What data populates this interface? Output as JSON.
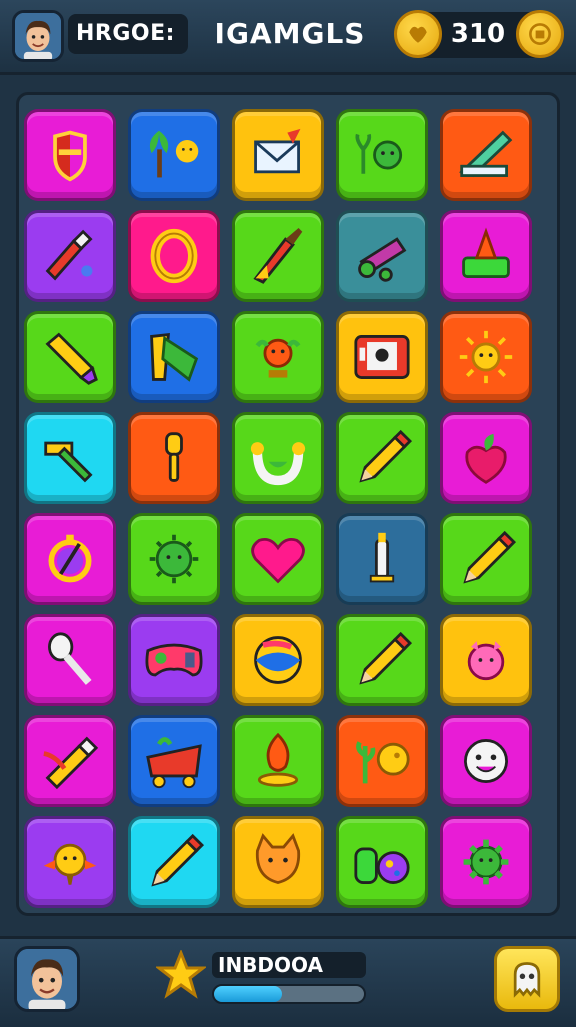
{
  "header": {
    "player_name": "HRGOE:",
    "title": "IGAMGLS",
    "coins": "310"
  },
  "footer": {
    "level_label": "INBDOOA",
    "progress": 0.45
  },
  "colors": {
    "magenta": "#e81cd6",
    "blue": "#1f6fe6",
    "yellow": "#ffc20e",
    "green": "#57d81a",
    "orange": "#ff5a14",
    "purple": "#9b3cf0",
    "pink": "#ff1a8c",
    "teal": "#3a8f9a",
    "cyan": "#1fd8f2",
    "darkblue": "#2d6e9c"
  },
  "board": {
    "rows": [
      [
        {
          "color": "magenta",
          "icon": "shield-icon"
        },
        {
          "color": "blue",
          "icon": "tree-sun-icon"
        },
        {
          "color": "yellow",
          "icon": "envelope-icon"
        },
        {
          "color": "green",
          "icon": "plant-creature-icon"
        },
        {
          "color": "orange",
          "icon": "ruler-icon"
        }
      ],
      [
        {
          "color": "purple",
          "icon": "paint-tube-icon"
        },
        {
          "color": "pink",
          "icon": "ring-icon"
        },
        {
          "color": "green",
          "icon": "brush-icon"
        },
        {
          "color": "teal",
          "icon": "wrench-icon"
        },
        {
          "color": "magenta",
          "icon": "cone-icon"
        }
      ],
      [
        {
          "color": "green",
          "icon": "marker-icon"
        },
        {
          "color": "blue",
          "icon": "broom-icon"
        },
        {
          "color": "green",
          "icon": "creature-icon"
        },
        {
          "color": "yellow",
          "icon": "picture-icon"
        },
        {
          "color": "orange",
          "icon": "sun-icon"
        }
      ],
      [
        {
          "color": "cyan",
          "icon": "hammer-icon"
        },
        {
          "color": "orange",
          "icon": "microphone-icon"
        },
        {
          "color": "green",
          "icon": "horseshoe-icon"
        },
        {
          "color": "green",
          "icon": "pencil-icon"
        },
        {
          "color": "magenta",
          "icon": "strawberry-icon"
        }
      ],
      [
        {
          "color": "magenta",
          "icon": "compass-icon"
        },
        {
          "color": "green",
          "icon": "virus-icon"
        },
        {
          "color": "green",
          "icon": "heart-icon"
        },
        {
          "color": "darkblue",
          "icon": "candle-icon"
        },
        {
          "color": "green",
          "icon": "pencil-icon"
        }
      ],
      [
        {
          "color": "magenta",
          "icon": "spoon-icon"
        },
        {
          "color": "purple",
          "icon": "gamepad-icon"
        },
        {
          "color": "yellow",
          "icon": "ball-icon"
        },
        {
          "color": "green",
          "icon": "pencil-icon"
        },
        {
          "color": "yellow",
          "icon": "pig-icon"
        }
      ],
      [
        {
          "color": "magenta",
          "icon": "crayon-icon"
        },
        {
          "color": "blue",
          "icon": "cart-icon"
        },
        {
          "color": "green",
          "icon": "flame-icon"
        },
        {
          "color": "orange",
          "icon": "moon-plant-icon"
        },
        {
          "color": "magenta",
          "icon": "smiley-icon"
        }
      ],
      [
        {
          "color": "purple",
          "icon": "bird-icon"
        },
        {
          "color": "cyan",
          "icon": "pencil-icon"
        },
        {
          "color": "yellow",
          "icon": "fox-icon"
        },
        {
          "color": "green",
          "icon": "potion-icon"
        },
        {
          "color": "magenta",
          "icon": "gear-creature-icon"
        }
      ]
    ]
  }
}
